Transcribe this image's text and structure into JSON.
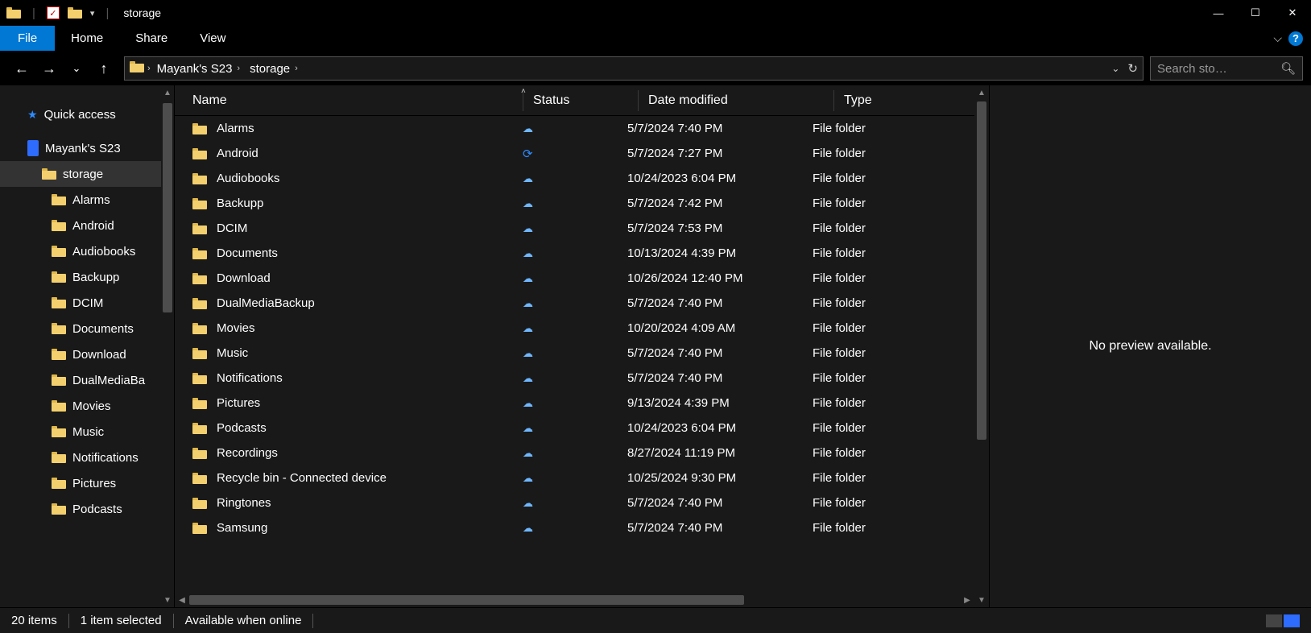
{
  "window": {
    "title": "storage"
  },
  "ribbon": {
    "file": "File",
    "tabs": [
      "Home",
      "Share",
      "View"
    ]
  },
  "breadcrumbs": [
    "Mayank's S23",
    "storage"
  ],
  "search": {
    "placeholder": "Search sto…"
  },
  "tree": {
    "quick_access": "Quick access",
    "device": "Mayank's S23",
    "selected": "storage",
    "children": [
      "Alarms",
      "Android",
      "Audiobooks",
      "Backupp",
      "DCIM",
      "Documents",
      "Download",
      "DualMediaBa",
      "Movies",
      "Music",
      "Notifications",
      "Pictures",
      "Podcasts"
    ]
  },
  "columns": {
    "name": "Name",
    "status": "Status",
    "date": "Date modified",
    "type": "Type"
  },
  "rows": [
    {
      "name": "Alarms",
      "status": "cloud",
      "date": "5/7/2024 7:40 PM",
      "type": "File folder"
    },
    {
      "name": "Android",
      "status": "sync",
      "date": "5/7/2024 7:27 PM",
      "type": "File folder"
    },
    {
      "name": "Audiobooks",
      "status": "cloud",
      "date": "10/24/2023 6:04 PM",
      "type": "File folder"
    },
    {
      "name": "Backupp",
      "status": "cloud",
      "date": "5/7/2024 7:42 PM",
      "type": "File folder"
    },
    {
      "name": "DCIM",
      "status": "cloud",
      "date": "5/7/2024 7:53 PM",
      "type": "File folder"
    },
    {
      "name": "Documents",
      "status": "cloud",
      "date": "10/13/2024 4:39 PM",
      "type": "File folder"
    },
    {
      "name": "Download",
      "status": "cloud",
      "date": "10/26/2024 12:40 PM",
      "type": "File folder"
    },
    {
      "name": "DualMediaBackup",
      "status": "cloud",
      "date": "5/7/2024 7:40 PM",
      "type": "File folder"
    },
    {
      "name": "Movies",
      "status": "cloud",
      "date": "10/20/2024 4:09 AM",
      "type": "File folder"
    },
    {
      "name": "Music",
      "status": "cloud",
      "date": "5/7/2024 7:40 PM",
      "type": "File folder"
    },
    {
      "name": "Notifications",
      "status": "cloud",
      "date": "5/7/2024 7:40 PM",
      "type": "File folder"
    },
    {
      "name": "Pictures",
      "status": "cloud",
      "date": "9/13/2024 4:39 PM",
      "type": "File folder"
    },
    {
      "name": "Podcasts",
      "status": "cloud",
      "date": "10/24/2023 6:04 PM",
      "type": "File folder"
    },
    {
      "name": "Recordings",
      "status": "cloud",
      "date": "8/27/2024 11:19 PM",
      "type": "File folder"
    },
    {
      "name": "Recycle bin - Connected device",
      "status": "cloud",
      "date": "10/25/2024 9:30 PM",
      "type": "File folder"
    },
    {
      "name": "Ringtones",
      "status": "cloud",
      "date": "5/7/2024 7:40 PM",
      "type": "File folder"
    },
    {
      "name": "Samsung",
      "status": "cloud",
      "date": "5/7/2024 7:40 PM",
      "type": "File folder"
    }
  ],
  "preview": {
    "text": "No preview available."
  },
  "status": {
    "items": "20 items",
    "selected": "1 item selected",
    "availability": "Available when online"
  }
}
